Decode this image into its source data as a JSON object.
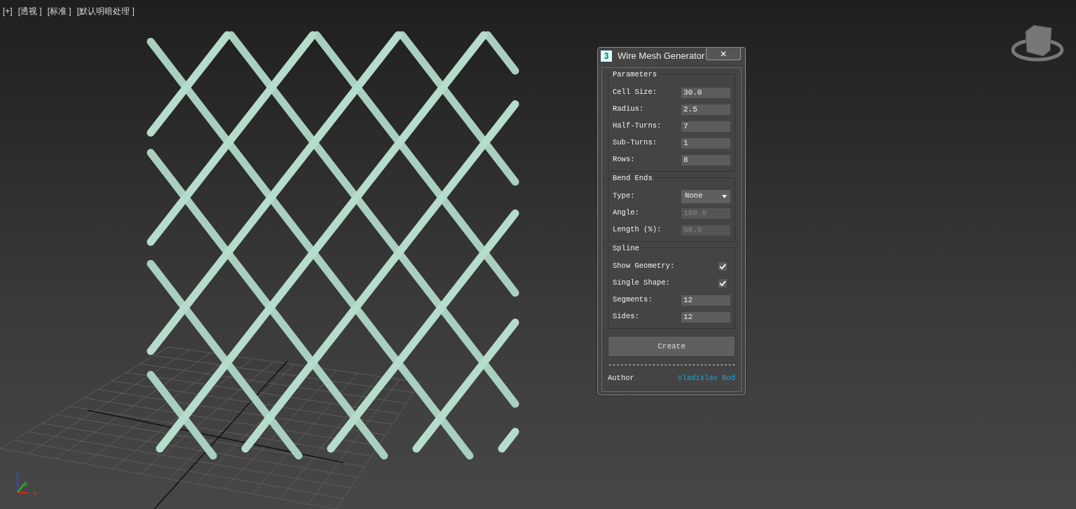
{
  "viewport": {
    "labels": [
      "[+]",
      "[透视 ]",
      "[标准 ]",
      "[默认明暗处理 ]"
    ],
    "axis_labels": [
      "z",
      "y",
      "x"
    ]
  },
  "dialog": {
    "app_badge": "3",
    "title": "Wire Mesh Generator",
    "close": "✕",
    "groups": [
      {
        "title": "Parameters",
        "rows": [
          {
            "kind": "spinner",
            "label": "Cell Size:",
            "value": "30.0",
            "disabled": false
          },
          {
            "kind": "spinner",
            "label": "Radius:",
            "value": "2.5",
            "disabled": false
          },
          {
            "kind": "spinner",
            "label": "Half-Turns:",
            "value": "7",
            "disabled": false
          },
          {
            "kind": "spinner",
            "label": "Sub-Turns:",
            "value": "1",
            "disabled": false
          },
          {
            "kind": "spinner",
            "label": "Rows:",
            "value": "8",
            "disabled": false
          }
        ]
      },
      {
        "title": "Bend Ends",
        "rows": [
          {
            "kind": "dropdown",
            "label": "Type:",
            "value": "None"
          },
          {
            "kind": "spinner",
            "label": "Angle:",
            "value": "180.0",
            "disabled": true
          },
          {
            "kind": "spinner",
            "label": "Length (%):",
            "value": "50.0",
            "disabled": true
          }
        ]
      },
      {
        "title": "Spline",
        "rows": [
          {
            "kind": "checkbox",
            "label": "Show Geometry:",
            "checked": true
          },
          {
            "kind": "checkbox",
            "label": "Single Shape:",
            "checked": true
          },
          {
            "kind": "spinner",
            "label": "Segments:",
            "value": "12",
            "disabled": false
          },
          {
            "kind": "spinner",
            "label": "Sides:",
            "value": "12",
            "disabled": false
          }
        ]
      }
    ],
    "create_button": "Create",
    "separator": "--------------------------------",
    "author_label": "Author",
    "author_name": "Vladislav Bod"
  }
}
